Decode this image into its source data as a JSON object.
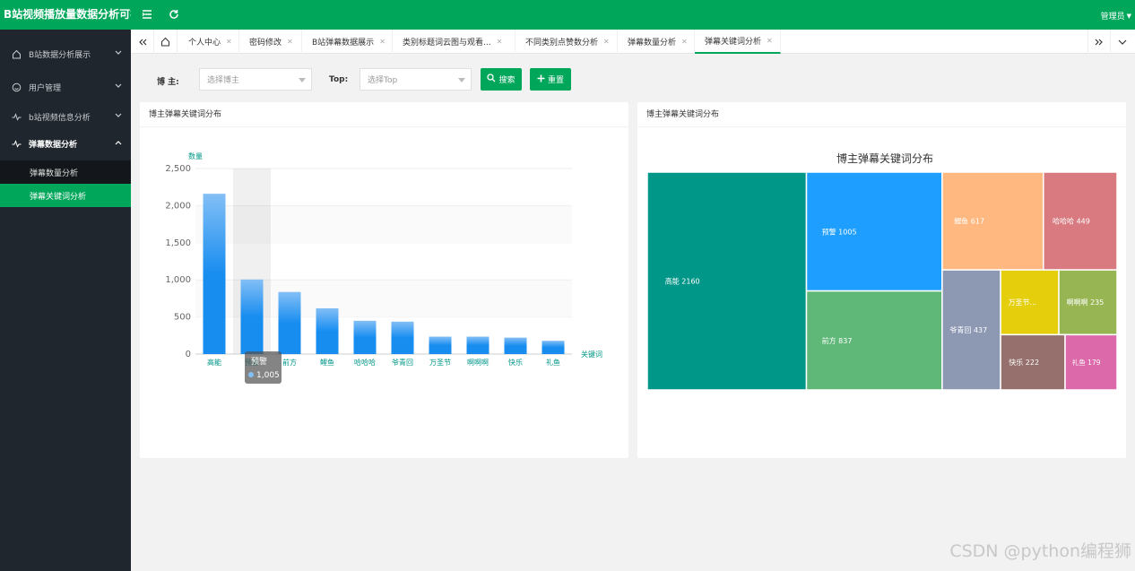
{
  "app": {
    "title": "B站视频播放量数据分析可视化",
    "user": "管理员"
  },
  "sidebar": {
    "items": [
      {
        "label": "B站数据分析展示",
        "icon": "home-icon"
      },
      {
        "label": "用户管理",
        "icon": "smile-icon"
      },
      {
        "label": "b站视频信息分析",
        "icon": "pulse-icon"
      },
      {
        "label": "弹幕数据分析",
        "icon": "pulse-icon"
      }
    ],
    "sub_items": [
      {
        "label": "弹幕数量分析"
      },
      {
        "label": "弹幕关键词分析"
      }
    ]
  },
  "tabs": [
    {
      "label": "个人中心"
    },
    {
      "label": "密码修改"
    },
    {
      "label": "B站弹幕数据展示"
    },
    {
      "label": "类别标题词云图与观看..."
    },
    {
      "label": "不同类别点赞数分析"
    },
    {
      "label": "弹幕数量分析"
    },
    {
      "label": "弹幕关键词分析"
    }
  ],
  "filters": {
    "blogger_label": "博  主:",
    "blogger_placeholder": "选择博主",
    "top_label": "Top:",
    "top_placeholder": "选择Top",
    "search_label": "搜索",
    "reset_label": "重置"
  },
  "left_card": {
    "title": "博主弹幕关键词分布"
  },
  "right_card": {
    "title": "博主弹幕关键词分布"
  },
  "chart_data": [
    {
      "type": "bar",
      "ylabel": "数量",
      "xlabel": "关键词",
      "ylim": [
        0,
        2500
      ],
      "yticks": [
        "0",
        "500",
        "1,000",
        "1,500",
        "2,000",
        "2,500"
      ],
      "categories": [
        "高能",
        "预警",
        "前方",
        "鲤鱼",
        "哈哈哈",
        "爷青回",
        "万圣节",
        "啊啊啊",
        "快乐",
        "礼鱼"
      ],
      "values": [
        2160,
        1005,
        837,
        617,
        449,
        437,
        235,
        235,
        222,
        179
      ],
      "tooltip": {
        "label": "预警",
        "value": "1,005"
      }
    },
    {
      "type": "treemap",
      "title": "博主弹幕关键词分布",
      "items": [
        {
          "label": "高能",
          "value": 2160,
          "text": "高能 2160",
          "color": "#009688"
        },
        {
          "label": "预警",
          "value": 1005,
          "text": "预警 1005",
          "color": "#1e9fff"
        },
        {
          "label": "前方",
          "value": 837,
          "text": "前方 837",
          "color": "#5fb878"
        },
        {
          "label": "鲤鱼",
          "value": 617,
          "text": "鲤鱼 617",
          "color": "#ffb980"
        },
        {
          "label": "哈哈哈",
          "value": 449,
          "text": "哈哈哈 449",
          "color": "#d87a80"
        },
        {
          "label": "爷青回",
          "value": 437,
          "text": "爷青回 437",
          "color": "#8d98b3"
        },
        {
          "label": "万圣节",
          "value": 235,
          "text": "万圣节...",
          "color": "#e5cf0d"
        },
        {
          "label": "啊啊啊",
          "value": 235,
          "text": "啊啊啊 235",
          "color": "#97b552"
        },
        {
          "label": "快乐",
          "value": 222,
          "text": "快乐 222",
          "color": "#95706d"
        },
        {
          "label": "礼鱼",
          "value": 179,
          "text": "礼鱼 179",
          "color": "#dc69aa"
        }
      ]
    }
  ],
  "watermark": "CSDN @python编程狮"
}
